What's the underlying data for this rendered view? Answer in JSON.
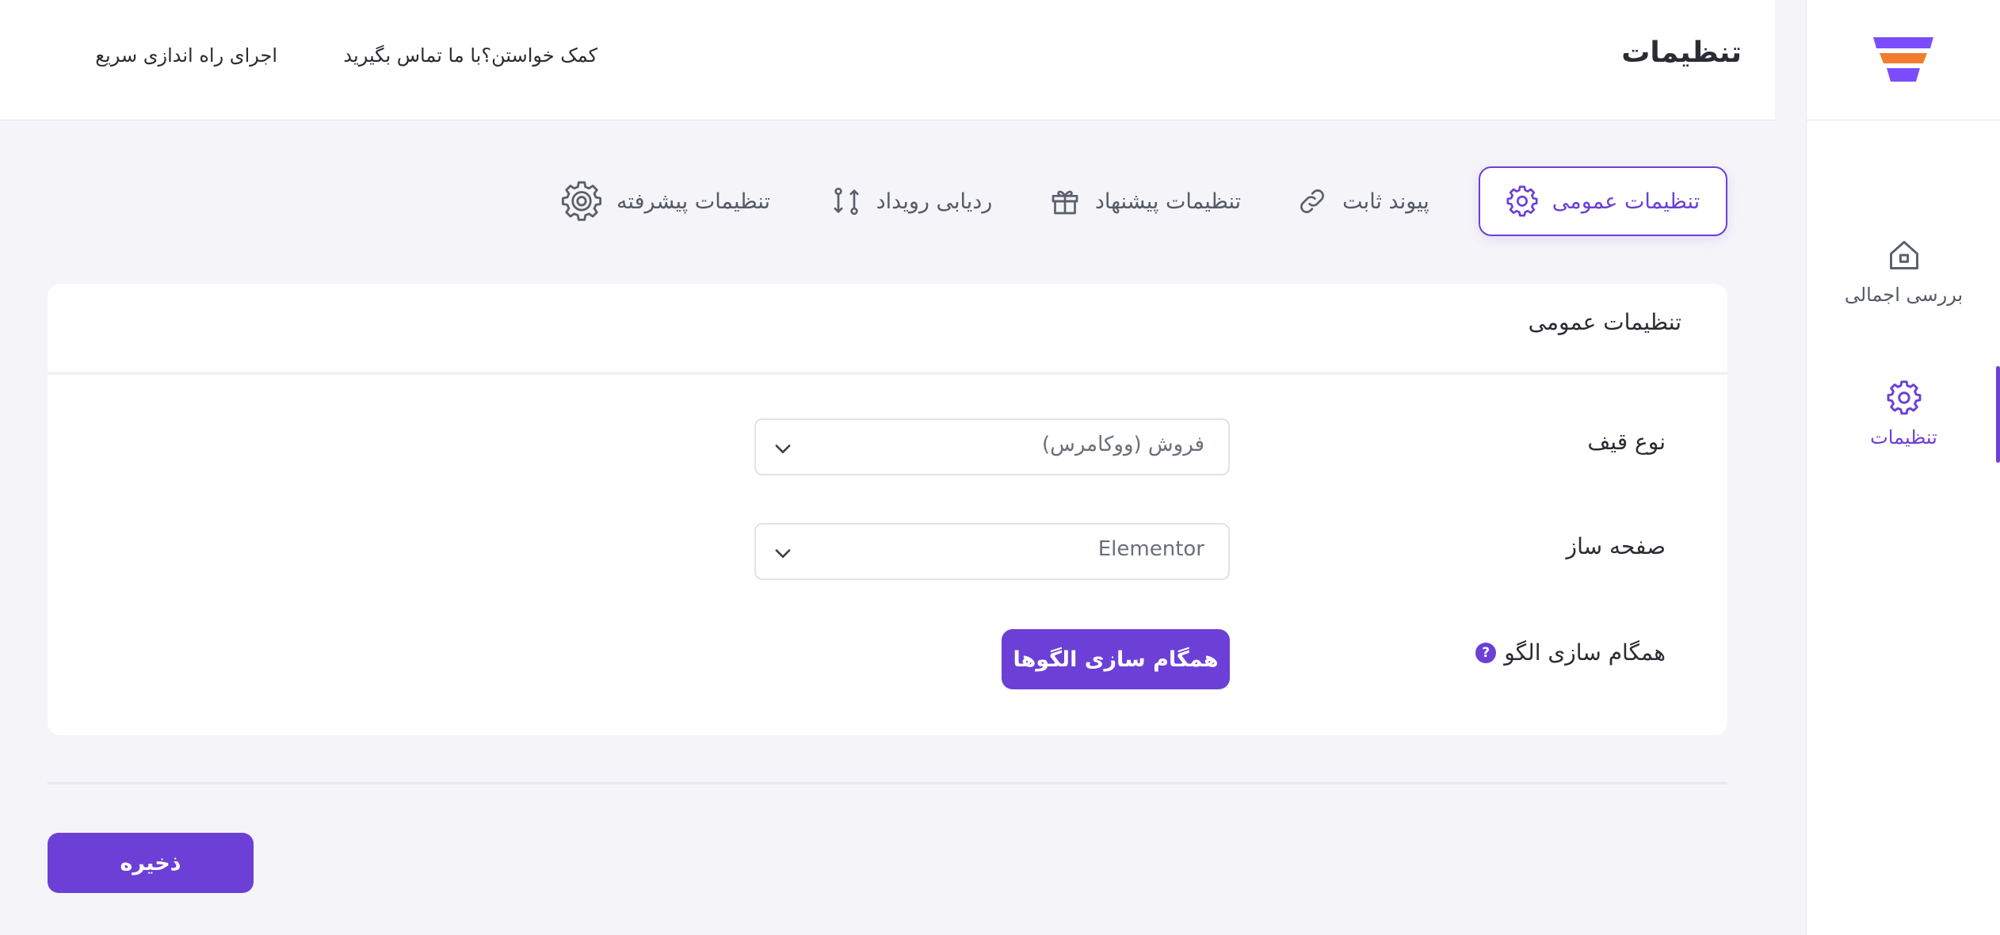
{
  "header": {
    "title": "تنظیمات",
    "help_link": "کمک خواستن؟با ما تماس بگیرید",
    "quick_setup_link": "اجرای راه اندازی سریع"
  },
  "sidebar": {
    "items": [
      {
        "label": "بررسی اجمالی",
        "icon": "home-icon"
      },
      {
        "label": "تنظیمات",
        "icon": "gear-icon",
        "active": true
      }
    ]
  },
  "tabs": [
    {
      "label": "تنظیمات عمومی",
      "icon": "gear-icon",
      "active": true
    },
    {
      "label": "پیوند ثابت",
      "icon": "link-icon"
    },
    {
      "label": "تنظیمات پیشنهاد",
      "icon": "gift-icon"
    },
    {
      "label": "ردیابی رویداد",
      "icon": "event-tracking-icon"
    },
    {
      "label": "تنظیمات پیشرفته",
      "icon": "advanced-gear-icon"
    }
  ],
  "card": {
    "title": "تنظیمات عمومی",
    "rows": {
      "funnel_type": {
        "label": "نوع قیف",
        "value": "فروش (ووکامرس)"
      },
      "page_builder": {
        "label": "صفحه ساز",
        "value": "Elementor"
      },
      "template_sync": {
        "label": "همگام سازی الگو",
        "help": "?",
        "button": "همگام سازی الگوها"
      }
    }
  },
  "save_label": "ذخیره",
  "colors": {
    "accent": "#6c3fd6",
    "logo_top": "#7c4dff",
    "logo_middle": "#f07d2e",
    "background": "#f4f4f9"
  }
}
